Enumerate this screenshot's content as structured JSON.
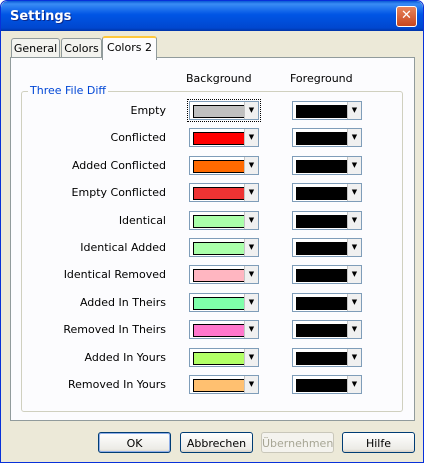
{
  "window": {
    "title": "Settings"
  },
  "tabs": [
    {
      "label": "General",
      "active": false
    },
    {
      "label": "Colors",
      "active": false
    },
    {
      "label": "Colors 2",
      "active": true
    }
  ],
  "columns": {
    "background": "Background",
    "foreground": "Foreground"
  },
  "group": {
    "title": "Three File Diff"
  },
  "rows": [
    {
      "label": "Empty",
      "background": "#c0c0c0",
      "foreground": "#000000"
    },
    {
      "label": "Conflicted",
      "background": "#ff0000",
      "foreground": "#000000"
    },
    {
      "label": "Added Conflicted",
      "background": "#ff6a00",
      "foreground": "#000000"
    },
    {
      "label": "Empty Conflicted",
      "background": "#ee3333",
      "foreground": "#000000"
    },
    {
      "label": "Identical",
      "background": "#aaffaa",
      "foreground": "#000000"
    },
    {
      "label": "Identical Added",
      "background": "#aaffaa",
      "foreground": "#000000"
    },
    {
      "label": "Identical Removed",
      "background": "#ffb6c1",
      "foreground": "#000000"
    },
    {
      "label": "Added In Theirs",
      "background": "#7fffaa",
      "foreground": "#000000"
    },
    {
      "label": "Removed In Theirs",
      "background": "#ff77cc",
      "foreground": "#000000"
    },
    {
      "label": "Added In Yours",
      "background": "#b2ff66",
      "foreground": "#000000"
    },
    {
      "label": "Removed In Yours",
      "background": "#ffc070",
      "foreground": "#000000"
    }
  ],
  "buttons": {
    "ok": "OK",
    "cancel": "Abbrechen",
    "apply": "Übernehmen",
    "help": "Hilfe"
  }
}
